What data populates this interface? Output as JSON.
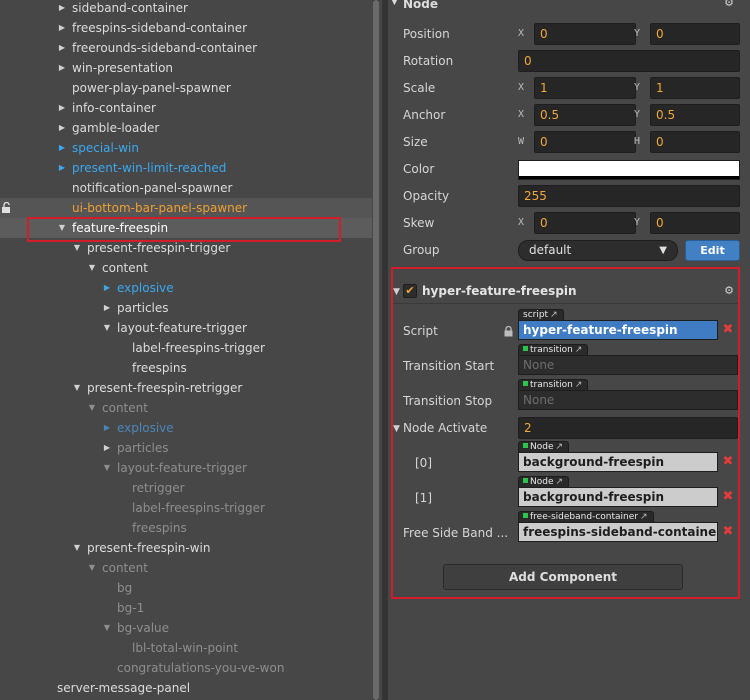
{
  "hierarchy": {
    "rows": [
      {
        "label": "sideband-container",
        "indent": 0,
        "arrow": "right",
        "style": "normal"
      },
      {
        "label": "freespins-sideband-container",
        "indent": 0,
        "arrow": "right",
        "style": "normal"
      },
      {
        "label": "freerounds-sideband-container",
        "indent": 0,
        "arrow": "right",
        "style": "normal"
      },
      {
        "label": "win-presentation",
        "indent": 0,
        "arrow": "right",
        "style": "normal"
      },
      {
        "label": "power-play-panel-spawner",
        "indent": 0,
        "arrow": "none",
        "style": "normal"
      },
      {
        "label": "info-container",
        "indent": 0,
        "arrow": "right",
        "style": "normal"
      },
      {
        "label": "gamble-loader",
        "indent": 0,
        "arrow": "right",
        "style": "normal"
      },
      {
        "label": "special-win",
        "indent": 0,
        "arrow": "right-blue",
        "style": "blue"
      },
      {
        "label": "present-win-limit-reached",
        "indent": 0,
        "arrow": "right-blue",
        "style": "blue"
      },
      {
        "label": "notification-panel-spawner",
        "indent": 0,
        "arrow": "none",
        "style": "normal"
      },
      {
        "label": "ui-bottom-bar-panel-spawner",
        "indent": 0,
        "arrow": "none",
        "style": "orange",
        "locked": true
      },
      {
        "label": "feature-freespin",
        "indent": 0,
        "arrow": "down",
        "style": "white",
        "selected": true
      },
      {
        "label": "present-freespin-trigger",
        "indent": 1,
        "arrow": "down",
        "style": "normal"
      },
      {
        "label": "content",
        "indent": 2,
        "arrow": "down",
        "style": "normal"
      },
      {
        "label": "explosive",
        "indent": 3,
        "arrow": "right-blue",
        "style": "blue"
      },
      {
        "label": "particles",
        "indent": 3,
        "arrow": "right",
        "style": "normal"
      },
      {
        "label": "layout-feature-trigger",
        "indent": 3,
        "arrow": "down",
        "style": "normal"
      },
      {
        "label": "label-freespins-trigger",
        "indent": 4,
        "arrow": "none",
        "style": "normal"
      },
      {
        "label": "freespins",
        "indent": 4,
        "arrow": "none",
        "style": "normal"
      },
      {
        "label": "present-freespin-retrigger",
        "indent": 1,
        "arrow": "down",
        "style": "normal"
      },
      {
        "label": "content",
        "indent": 2,
        "arrow": "down",
        "style": "dim"
      },
      {
        "label": "explosive",
        "indent": 3,
        "arrow": "right-dimblue",
        "style": "dimblue"
      },
      {
        "label": "particles",
        "indent": 3,
        "arrow": "right",
        "style": "dim"
      },
      {
        "label": "layout-feature-trigger",
        "indent": 3,
        "arrow": "down",
        "style": "dim"
      },
      {
        "label": "retrigger",
        "indent": 4,
        "arrow": "none",
        "style": "dim"
      },
      {
        "label": "label-freespins-trigger",
        "indent": 4,
        "arrow": "none",
        "style": "dim"
      },
      {
        "label": "freespins",
        "indent": 4,
        "arrow": "none",
        "style": "dim"
      },
      {
        "label": "present-freespin-win",
        "indent": 1,
        "arrow": "down",
        "style": "normal"
      },
      {
        "label": "content",
        "indent": 2,
        "arrow": "down",
        "style": "dim"
      },
      {
        "label": "bg",
        "indent": 3,
        "arrow": "none",
        "style": "dim"
      },
      {
        "label": "bg-1",
        "indent": 3,
        "arrow": "none",
        "style": "dim"
      },
      {
        "label": "bg-value",
        "indent": 3,
        "arrow": "down",
        "style": "dim"
      },
      {
        "label": "lbl-total-win-point",
        "indent": 4,
        "arrow": "none",
        "style": "dim"
      },
      {
        "label": "congratulations-you-ve-won",
        "indent": 3,
        "arrow": "none",
        "style": "dim"
      },
      {
        "label": "server-message-panel",
        "indent": -1,
        "arrow": "none",
        "style": "normal"
      }
    ]
  },
  "inspector": {
    "node_section": "Node",
    "position": {
      "label": "Position",
      "x_axis": "X",
      "x": "0",
      "y_axis": "Y",
      "y": "0"
    },
    "rotation": {
      "label": "Rotation",
      "value": "0"
    },
    "scale": {
      "label": "Scale",
      "x_axis": "X",
      "x": "1",
      "y_axis": "Y",
      "y": "1"
    },
    "anchor": {
      "label": "Anchor",
      "x_axis": "X",
      "x": "0.5",
      "y_axis": "Y",
      "y": "0.5"
    },
    "size": {
      "label": "Size",
      "w_axis": "W",
      "w": "0",
      "h_axis": "H",
      "h": "0"
    },
    "color": {
      "label": "Color",
      "value": "#ffffff"
    },
    "opacity": {
      "label": "Opacity",
      "value": "255"
    },
    "skew": {
      "label": "Skew",
      "x_axis": "X",
      "x": "0",
      "y_axis": "Y",
      "y": "0"
    },
    "group": {
      "label": "Group",
      "value": "default",
      "edit": "Edit"
    },
    "component": {
      "title": "hyper-feature-freespin",
      "enabled": true,
      "script": {
        "label": "Script",
        "tag": "script",
        "value": "hyper-feature-freespin"
      },
      "transition_start": {
        "label": "Transition Start",
        "tag": "transition",
        "value": "None"
      },
      "transition_stop": {
        "label": "Transition Stop",
        "tag": "transition",
        "value": "None"
      },
      "node_activate": {
        "label": "Node Activate",
        "count": "2",
        "items": [
          {
            "label": "[0]",
            "tag": "Node",
            "value": "background-freespin"
          },
          {
            "label": "[1]",
            "tag": "Node",
            "value": "background-freespin"
          }
        ]
      },
      "free_side_band": {
        "label": "Free Side Band ...",
        "tag": "free-sideband-container",
        "value": "freespins-sideband-container"
      }
    },
    "add_component": "Add Component"
  },
  "colors": {
    "highlight": "#d21e2a",
    "accent_blue": "#3aa8f0",
    "value_orange": "#f2a73b"
  }
}
